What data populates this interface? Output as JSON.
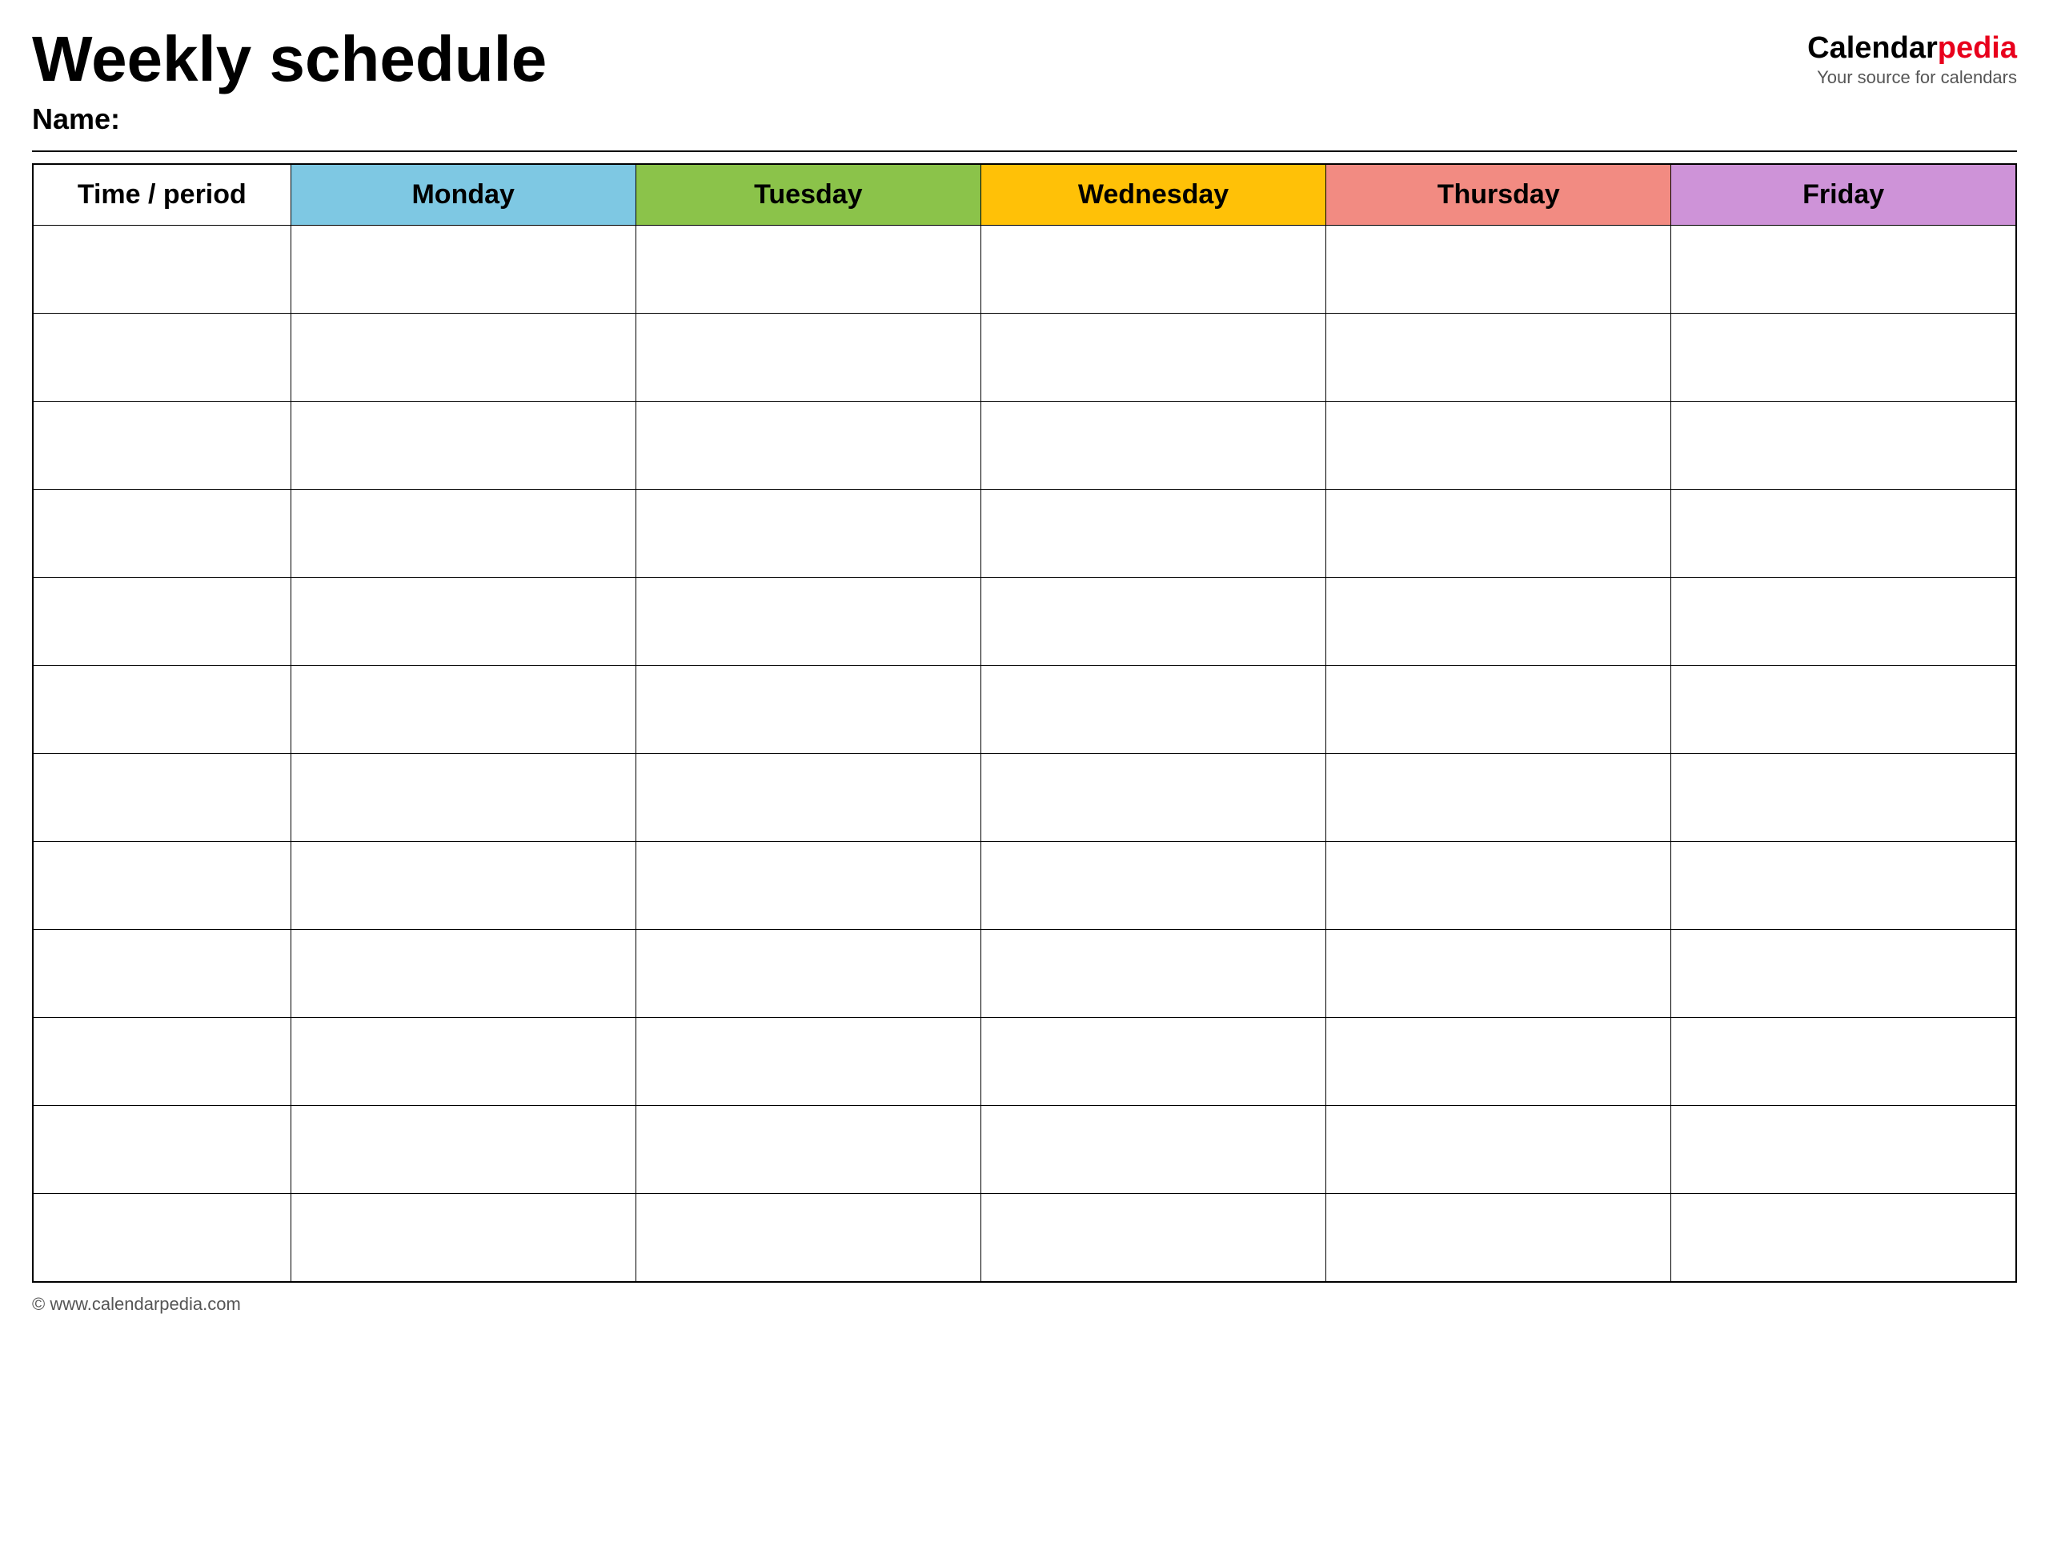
{
  "header": {
    "title": "Weekly schedule",
    "name_label": "Name:",
    "logo_calendar": "Calendar",
    "logo_pedia": "pedia",
    "logo_subtitle": "Your source for calendars"
  },
  "table": {
    "columns": [
      {
        "id": "time",
        "label": "Time / period",
        "color_class": "col-time"
      },
      {
        "id": "monday",
        "label": "Monday",
        "color_class": "col-monday"
      },
      {
        "id": "tuesday",
        "label": "Tuesday",
        "color_class": "col-tuesday"
      },
      {
        "id": "wednesday",
        "label": "Wednesday",
        "color_class": "col-wednesday"
      },
      {
        "id": "thursday",
        "label": "Thursday",
        "color_class": "col-thursday"
      },
      {
        "id": "friday",
        "label": "Friday",
        "color_class": "col-friday"
      }
    ],
    "row_count": 12
  },
  "footer": {
    "url": "© www.calendarpedia.com"
  }
}
